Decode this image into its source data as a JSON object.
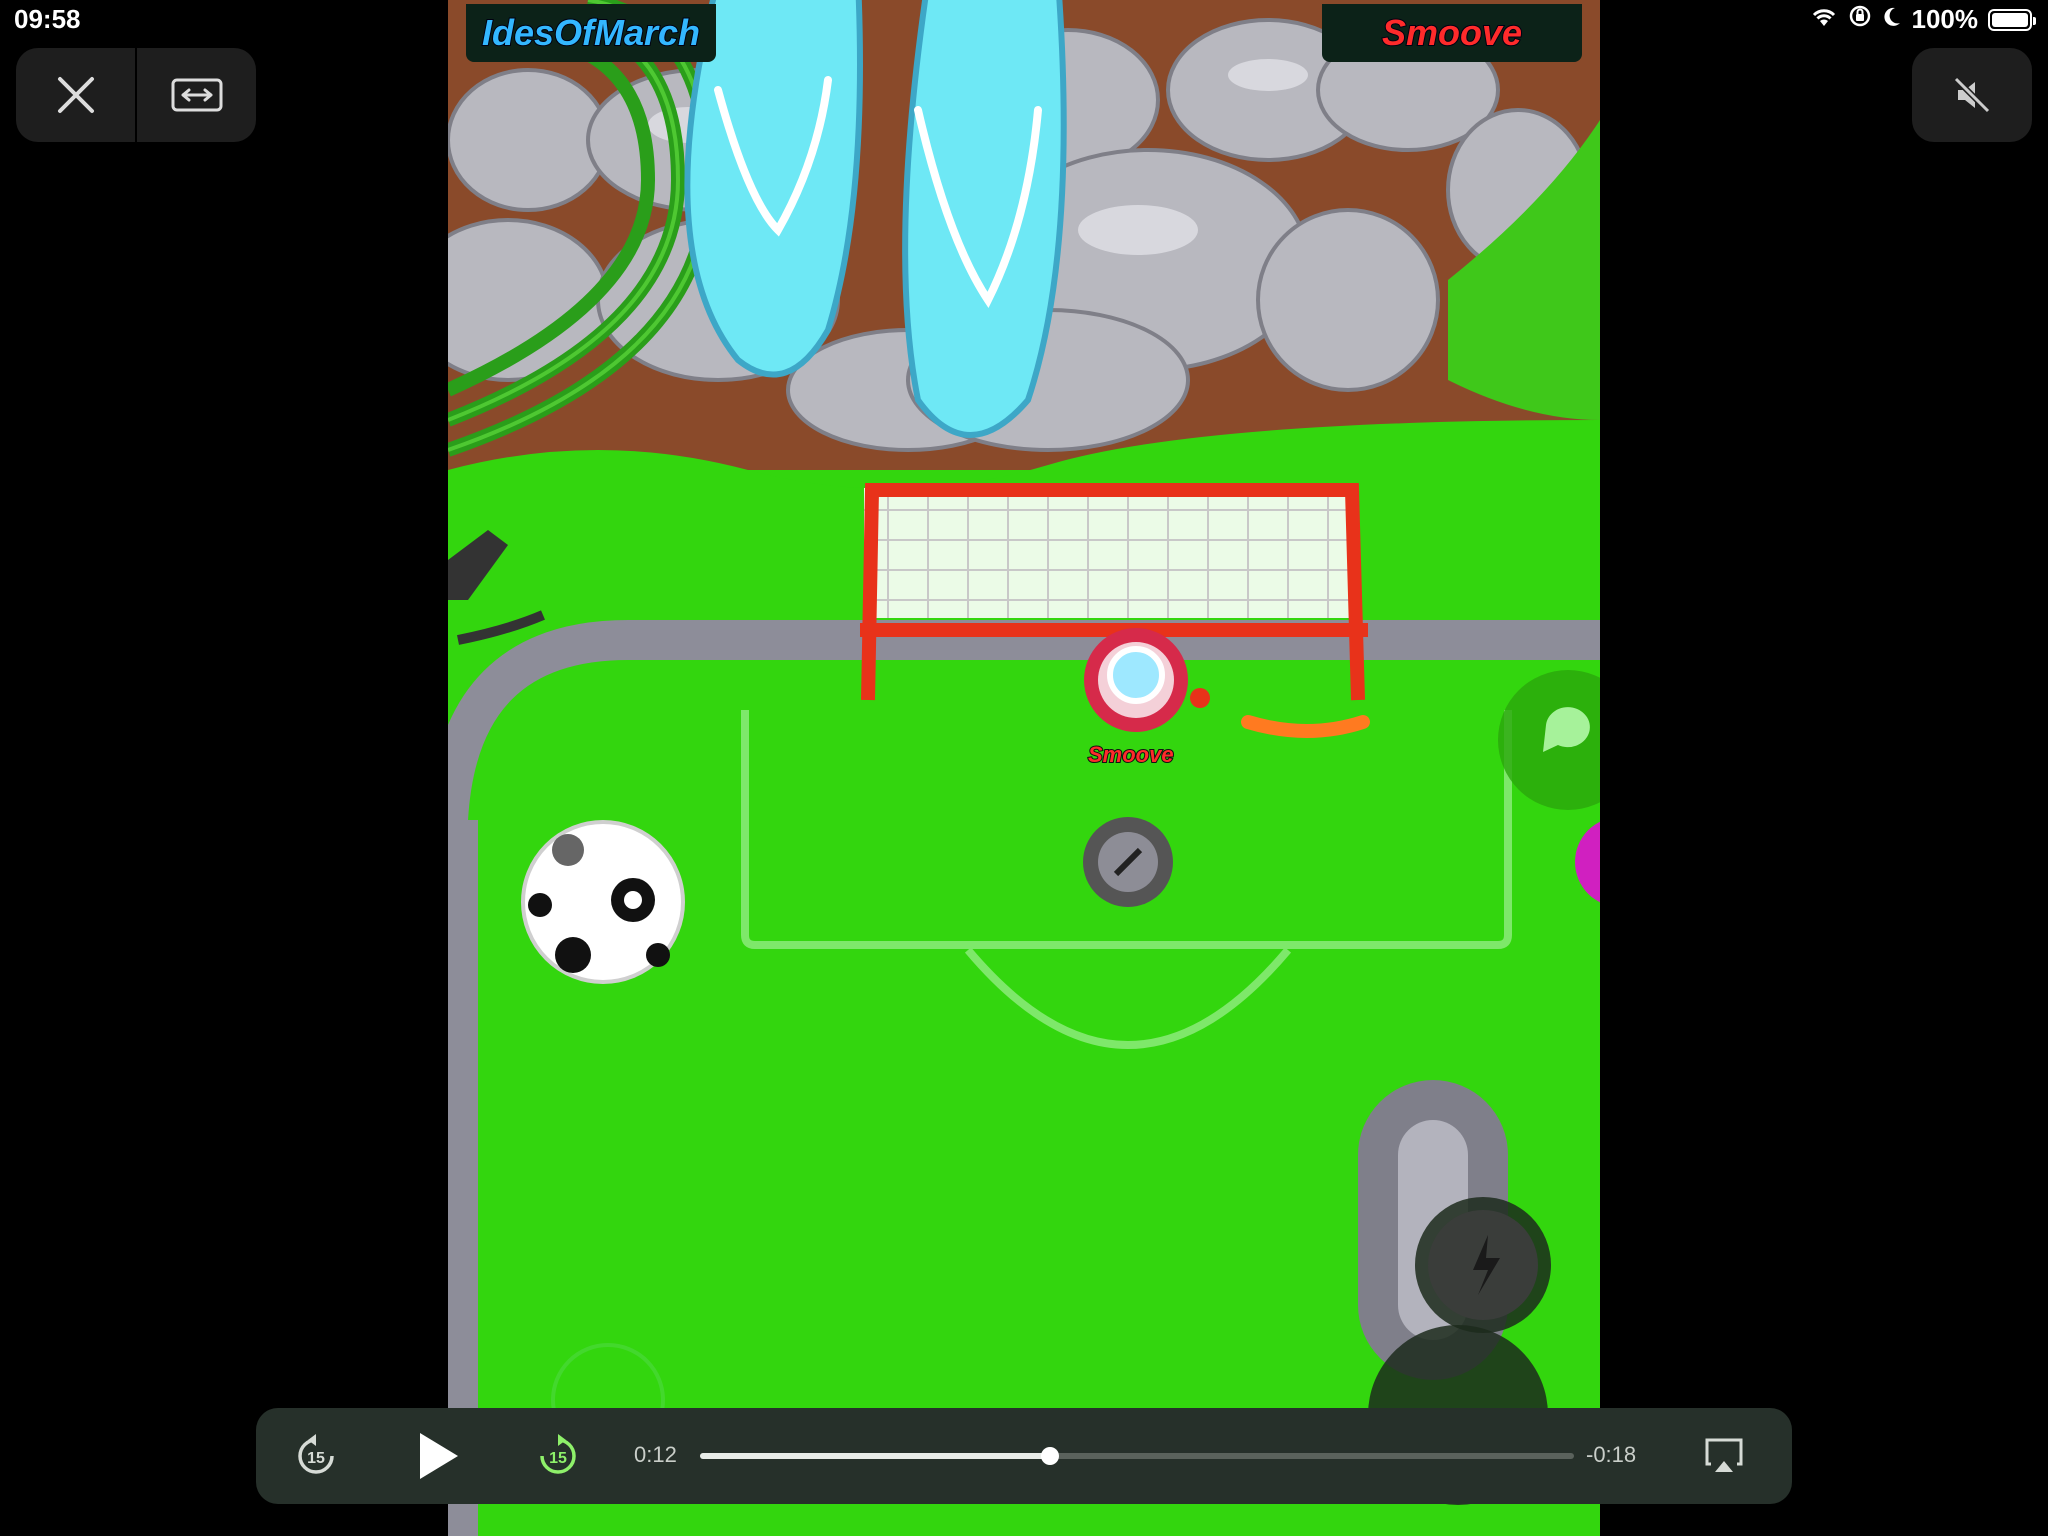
{
  "status_bar": {
    "time": "09:58",
    "battery_text": "100%",
    "battery_level": 1.0,
    "icons": [
      "wifi-icon",
      "orientation-lock-icon",
      "moon-icon",
      "battery-icon"
    ]
  },
  "top_controls": {
    "close_icon": "close-icon",
    "fullscreen_icon": "expand-horizontal-icon",
    "mute_icon": "speaker-muted-icon"
  },
  "game": {
    "player_left": "IdesOfMarch",
    "player_right": "Smoove",
    "player_tag": "Smoove"
  },
  "video_controls": {
    "rewind_icon": "skip-back-15-icon",
    "rewind_label": "15",
    "play_icon": "play-icon",
    "forward_icon": "skip-forward-15-icon",
    "forward_label": "15",
    "elapsed": "0:12",
    "remaining": "-0:18",
    "progress": 0.4,
    "airplay_icon": "airplay-icon"
  },
  "colors": {
    "grass": "#33d60e",
    "player_left": "#33b7ff",
    "player_right": "#ff2b2b",
    "goal_frame": "#e8321a"
  }
}
